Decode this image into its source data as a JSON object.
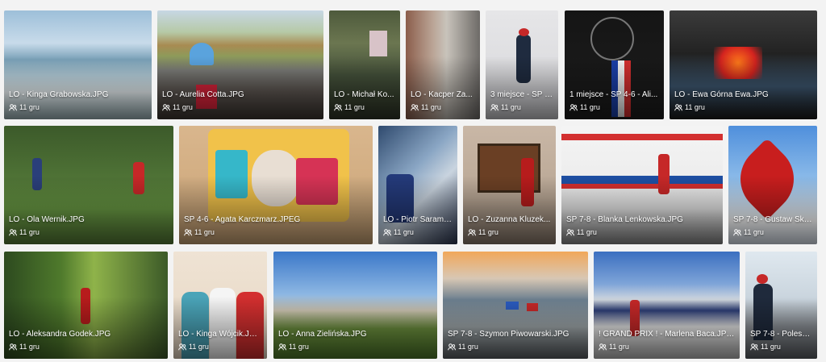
{
  "gallery": {
    "items": [
      {
        "title": "LO - Kinga Grabowska.JPG",
        "count": "11 gru"
      },
      {
        "title": "LO - Aurelia Cotta.JPG",
        "count": "11 gru"
      },
      {
        "title": "LO - Michał Ko...",
        "count": "11 gru"
      },
      {
        "title": "LO - Kacper Za...",
        "count": "11 gru"
      },
      {
        "title": "3 miejsce - SP 7...",
        "count": "11 gru"
      },
      {
        "title": "1 miejsce - SP 4-6 - Ali...",
        "count": "11 gru"
      },
      {
        "title": "LO - Ewa Górna Ewa.JPG",
        "count": "11 gru"
      },
      {
        "title": "LO - Ola Wernik.JPG",
        "count": "11 gru"
      },
      {
        "title": "SP 4-6 - Agata Karczmarz.JPEG",
        "count": "11 gru"
      },
      {
        "title": "LO - Piotr Sarama...",
        "count": "11 gru"
      },
      {
        "title": "LO - Zuzanna Kluzek...",
        "count": "11 gru"
      },
      {
        "title": "SP 7-8 - Blanka Lenkowska.JPG",
        "count": "11 gru"
      },
      {
        "title": "SP 7-8 - Gustaw Ski...",
        "count": "11 gru"
      },
      {
        "title": "LO - Aleksandra Godek.JPG",
        "count": "11 gru"
      },
      {
        "title": "LO - Kinga Wójcik.JPEG",
        "count": "11 gru"
      },
      {
        "title": "LO - Anna Zielińska.JPG",
        "count": "11 gru"
      },
      {
        "title": "SP 7-8 - Szymon Piwowarski.JPG",
        "count": "11 gru"
      },
      {
        "title": "! GRAND PRIX ! - Marlena Baca.JPEG",
        "count": "11 gru"
      },
      {
        "title": "SP 7-8 - Polesz...",
        "count": "11 gru"
      }
    ]
  }
}
